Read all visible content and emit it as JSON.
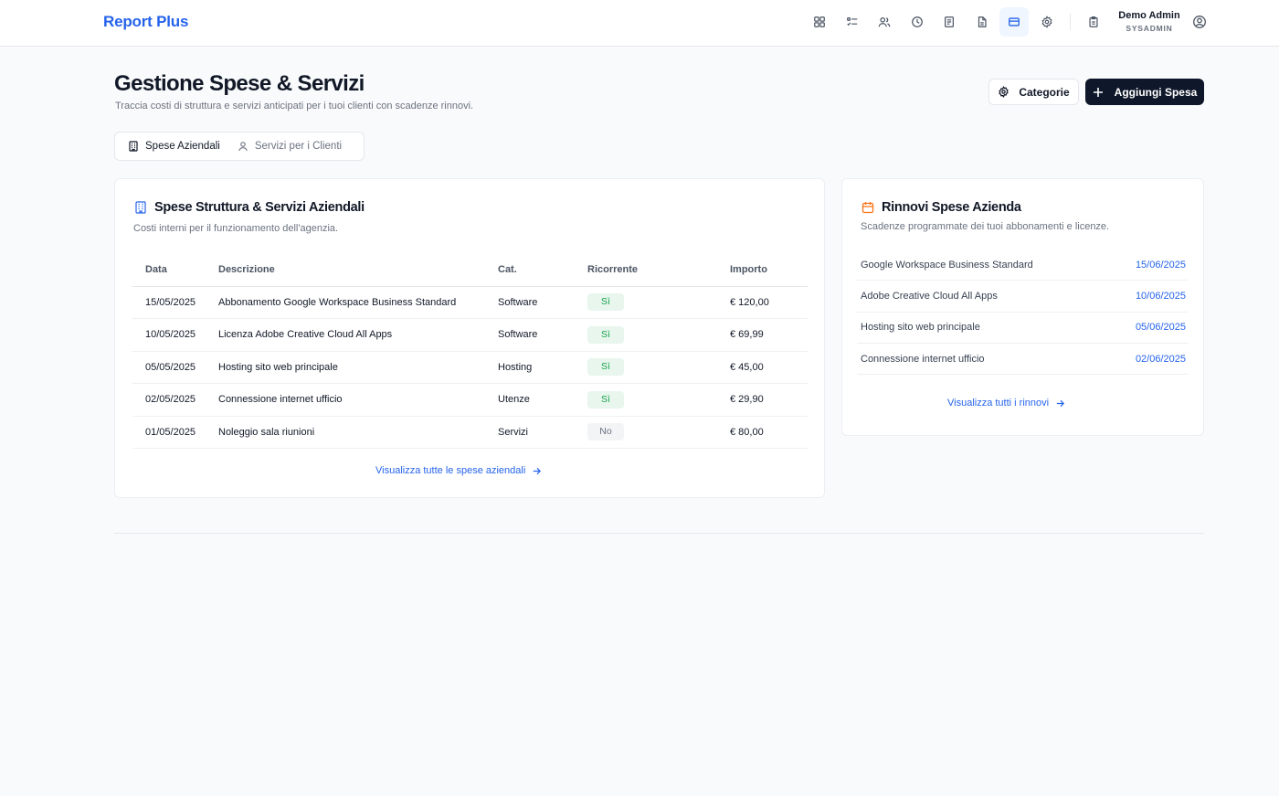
{
  "app": {
    "brand": "Report Plus"
  },
  "nav": {
    "icons": [
      "dashboard-icon",
      "tasks-icon",
      "users-icon",
      "clock-icon",
      "report-icon",
      "document-icon",
      "credit-card-icon",
      "settings-icon",
      "clipboard-icon"
    ],
    "active": "credit-card-icon"
  },
  "user": {
    "name": "Demo Admin",
    "role": "SYSADMIN"
  },
  "header": {
    "title": "Gestione Spese & Servizi",
    "subtitle": "Traccia costi di struttura e servizi anticipati per i tuoi clienti con scadenze rinnovi.",
    "categories_label": "Categorie",
    "add_label": "Aggiungi Spesa"
  },
  "tabs": [
    {
      "label": "Spese Aziendali",
      "active": true
    },
    {
      "label": "Servizi per i Clienti",
      "active": false
    }
  ],
  "expenses": {
    "title": "Spese Struttura & Servizi Aziendali",
    "subtitle": "Costi interni per il funzionamento dell'agenzia.",
    "columns": [
      "Data",
      "Descrizione",
      "Cat.",
      "Ricorrente",
      "Importo"
    ],
    "rows": [
      {
        "date": "15/05/2025",
        "desc": "Abbonamento Google Workspace Business Standard",
        "cat": "Software",
        "recurring": "Sì",
        "amount": "€ 120,00"
      },
      {
        "date": "10/05/2025",
        "desc": "Licenza Adobe Creative Cloud All Apps",
        "cat": "Software",
        "recurring": "Sì",
        "amount": "€ 69,99"
      },
      {
        "date": "05/05/2025",
        "desc": "Hosting sito web principale",
        "cat": "Hosting",
        "recurring": "Sì",
        "amount": "€ 45,00"
      },
      {
        "date": "02/05/2025",
        "desc": "Connessione internet ufficio",
        "cat": "Utenze",
        "recurring": "Sì",
        "amount": "€ 29,90"
      },
      {
        "date": "01/05/2025",
        "desc": "Noleggio sala riunioni",
        "cat": "Servizi",
        "recurring": "No",
        "amount": "€ 80,00"
      }
    ],
    "view_all": "Visualizza tutte le spese aziendali"
  },
  "renewals": {
    "title": "Rinnovi Spese Azienda",
    "subtitle": "Scadenze programmate dei tuoi abbonamenti e licenze.",
    "items": [
      {
        "name": "Google Workspace Business Standard",
        "date": "15/06/2025"
      },
      {
        "name": "Adobe Creative Cloud All Apps",
        "date": "10/06/2025"
      },
      {
        "name": "Hosting sito web principale",
        "date": "05/06/2025"
      },
      {
        "name": "Connessione internet ufficio",
        "date": "02/06/2025"
      }
    ],
    "view_all": "Visualizza tutti i rinnovi"
  },
  "colors": {
    "brand": "#2563eb",
    "primary_button": "#0f172a",
    "recurring_yes": "#16a34a",
    "calendar_accent": "#f97316"
  }
}
